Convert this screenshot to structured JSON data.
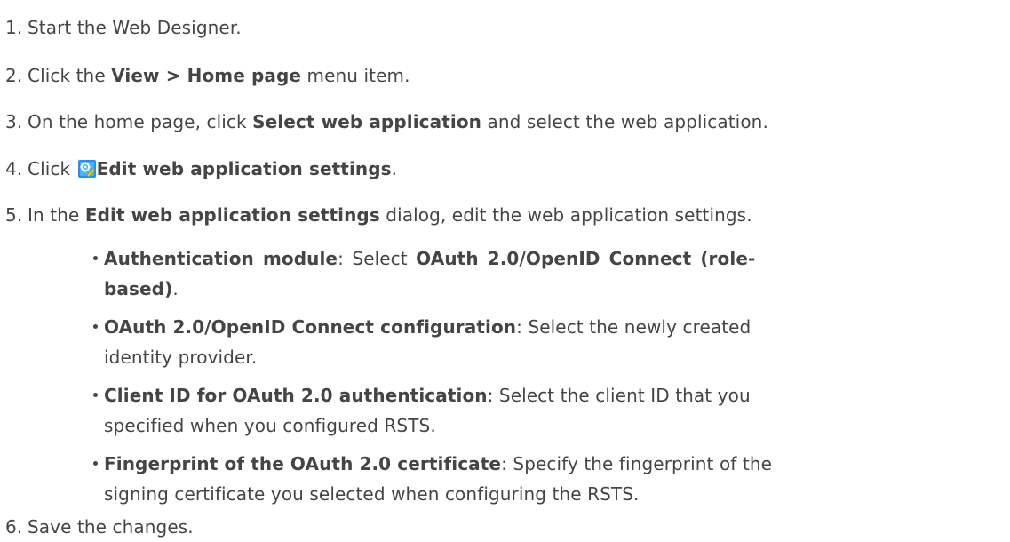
{
  "steps": [
    {
      "num": "1.",
      "text": "Start the Web Designer."
    },
    {
      "num": "2.",
      "pre": "Click the ",
      "bold": "View > Home page",
      "post": " menu item."
    },
    {
      "num": "3.",
      "pre": "On the home page, click ",
      "bold": "Select web application",
      "post": " and select the web application."
    },
    {
      "num": "4.",
      "pre": "Click ",
      "icon": "edit-settings-icon",
      "bold": "Edit web application settings",
      "post": "."
    },
    {
      "num": "5.",
      "pre": "In the ",
      "bold": "Edit web application settings",
      "post": " dialog, edit the web application settings."
    },
    {
      "num": "6.",
      "text": "Save the changes."
    }
  ],
  "bullets": [
    {
      "bold": "Authentication module",
      "line1_rest": ": Select ",
      "line1_bold": "OAuth 2.0/OpenID Connect (role-",
      "line2_bold": "based)",
      "line2_rest": "."
    },
    {
      "bold": "OAuth 2.0/OpenID Connect configuration",
      "line1_rest": ": Select the newly created",
      "line2_rest": "identity provider."
    },
    {
      "bold": "Client ID for OAuth 2.0 authentication",
      "line1_rest": ": Select the client ID that you",
      "line2_rest": "specified when you configured RSTS."
    },
    {
      "bold": "Fingerprint of the OAuth 2.0 certificate",
      "line1_rest": ": Specify the fingerprint of the",
      "line2_rest": "signing certificate you selected when configuring the RSTS."
    }
  ],
  "colors": {
    "text": "#454545",
    "icon_blue": "#1e90ff",
    "icon_yellow": "#f5d000"
  }
}
